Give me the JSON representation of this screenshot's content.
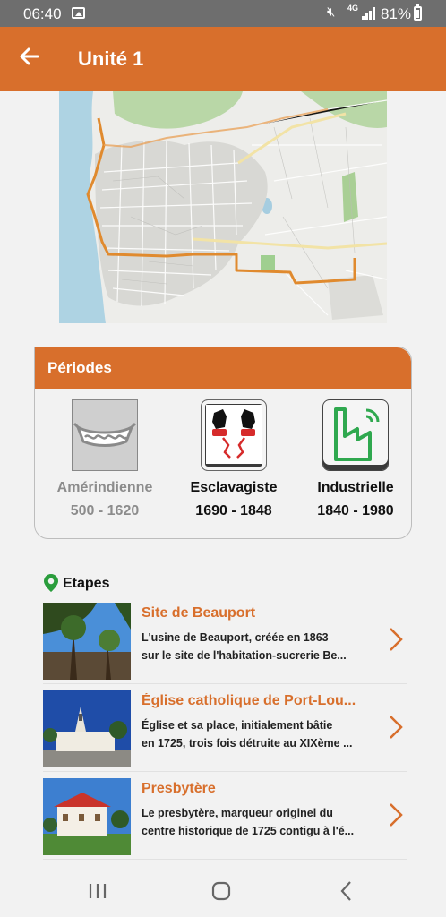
{
  "status_bar": {
    "time": "06:40",
    "network": "4G",
    "battery": "81%"
  },
  "header": {
    "title": "Unité 1",
    "back_icon": "arrow-left-icon"
  },
  "periods": {
    "heading": "Périodes",
    "items": [
      {
        "name": "Amérindienne",
        "years": "500 - 1620",
        "icon": "canoe-icon",
        "active": false
      },
      {
        "name": "Esclavagiste",
        "years": "1690 - 1848",
        "icon": "broken-chains-icon",
        "active": true
      },
      {
        "name": "Industrielle",
        "years": "1840 - 1980",
        "icon": "factory-icon",
        "active": true
      }
    ]
  },
  "stages": {
    "heading": "Etapes",
    "items": [
      {
        "title": "Site de Beauport",
        "line1": "L'usine de Beauport, créée en 1863",
        "line2": "sur le site de l'habitation-sucrerie Be..."
      },
      {
        "title": "Église catholique de Port-Lou...",
        "line1": "Église et sa place, initialement bâtie",
        "line2": "en 1725, trois fois détruite au XIXème ..."
      },
      {
        "title": "Presbytère",
        "line1": "Le presbytère, marqueur originel du",
        "line2": "centre historique de 1725 contigu à l'é..."
      }
    ]
  },
  "colors": {
    "accent": "#d86f2c",
    "status_bar": "#6e6e6e",
    "route": "#e08a2e"
  }
}
